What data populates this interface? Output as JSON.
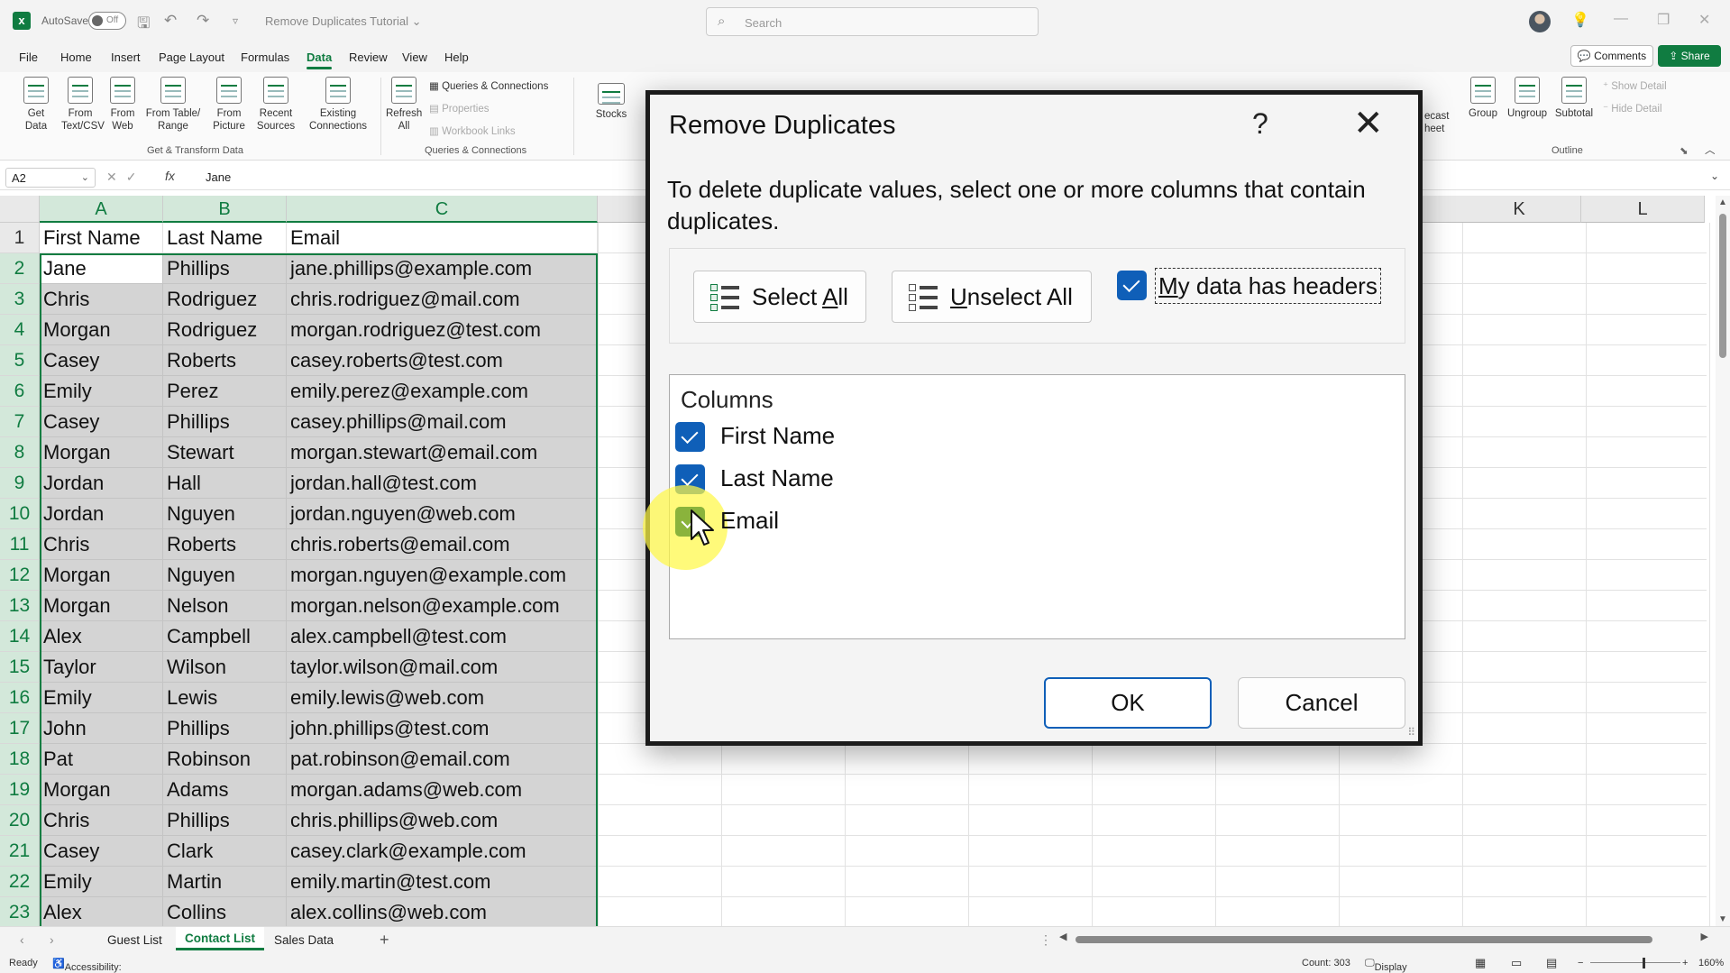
{
  "titlebar": {
    "autosave_label": "AutoSave",
    "autosave_state": "Off",
    "document_title": "Remove Duplicates Tutorial",
    "search_placeholder": "Search"
  },
  "menu": {
    "tabs": [
      "File",
      "Home",
      "Insert",
      "Page Layout",
      "Formulas",
      "Data",
      "Review",
      "View",
      "Help"
    ],
    "active_tab": "Data",
    "comments_label": "Comments",
    "share_label": "Share"
  },
  "ribbon": {
    "get_transform": {
      "buttons": [
        "Get Data",
        "From Text/CSV",
        "From Web",
        "From Table/ Range",
        "From Picture",
        "Recent Sources",
        "Existing Connections"
      ],
      "label": "Get & Transform Data"
    },
    "queries": {
      "refresh_label": "Refresh All",
      "items": [
        "Queries & Connections",
        "Properties",
        "Workbook Links"
      ],
      "label": "Queries & Connections"
    },
    "stocks_label": "Stocks",
    "forecast_label": "ecast heet",
    "outline": {
      "buttons": [
        "Group",
        "Ungroup",
        "Subtotal"
      ],
      "show_detail": "Show Detail",
      "hide_detail": "Hide Detail",
      "label": "Outline"
    }
  },
  "formula_bar": {
    "name_box": "A2",
    "fx": "fx",
    "value": "Jane"
  },
  "sheet": {
    "columns": [
      "A",
      "B",
      "C",
      "K",
      "L"
    ],
    "rows": [
      {
        "n": "1",
        "a": "First Name",
        "b": "Last Name",
        "c": "Email"
      },
      {
        "n": "2",
        "a": "Jane",
        "b": "Phillips",
        "c": "jane.phillips@example.com"
      },
      {
        "n": "3",
        "a": "Chris",
        "b": "Rodriguez",
        "c": "chris.rodriguez@mail.com"
      },
      {
        "n": "4",
        "a": "Morgan",
        "b": "Rodriguez",
        "c": "morgan.rodriguez@test.com"
      },
      {
        "n": "5",
        "a": "Casey",
        "b": "Roberts",
        "c": "casey.roberts@test.com"
      },
      {
        "n": "6",
        "a": "Emily",
        "b": "Perez",
        "c": "emily.perez@example.com"
      },
      {
        "n": "7",
        "a": "Casey",
        "b": "Phillips",
        "c": "casey.phillips@mail.com"
      },
      {
        "n": "8",
        "a": "Morgan",
        "b": "Stewart",
        "c": "morgan.stewart@email.com"
      },
      {
        "n": "9",
        "a": "Jordan",
        "b": "Hall",
        "c": "jordan.hall@test.com"
      },
      {
        "n": "10",
        "a": "Jordan",
        "b": "Nguyen",
        "c": "jordan.nguyen@web.com"
      },
      {
        "n": "11",
        "a": "Chris",
        "b": "Roberts",
        "c": "chris.roberts@email.com"
      },
      {
        "n": "12",
        "a": "Morgan",
        "b": "Nguyen",
        "c": "morgan.nguyen@example.com"
      },
      {
        "n": "13",
        "a": "Morgan",
        "b": "Nelson",
        "c": "morgan.nelson@example.com"
      },
      {
        "n": "14",
        "a": "Alex",
        "b": "Campbell",
        "c": "alex.campbell@test.com"
      },
      {
        "n": "15",
        "a": "Taylor",
        "b": "Wilson",
        "c": "taylor.wilson@mail.com"
      },
      {
        "n": "16",
        "a": "Emily",
        "b": "Lewis",
        "c": "emily.lewis@web.com"
      },
      {
        "n": "17",
        "a": "John",
        "b": "Phillips",
        "c": "john.phillips@test.com"
      },
      {
        "n": "18",
        "a": "Pat",
        "b": "Robinson",
        "c": "pat.robinson@email.com"
      },
      {
        "n": "19",
        "a": "Morgan",
        "b": "Adams",
        "c": "morgan.adams@web.com"
      },
      {
        "n": "20",
        "a": "Chris",
        "b": "Phillips",
        "c": "chris.phillips@web.com"
      },
      {
        "n": "21",
        "a": "Casey",
        "b": "Clark",
        "c": "casey.clark@example.com"
      },
      {
        "n": "22",
        "a": "Emily",
        "b": "Martin",
        "c": "emily.martin@test.com"
      },
      {
        "n": "23",
        "a": "Alex",
        "b": "Collins",
        "c": "alex.collins@web.com"
      }
    ]
  },
  "sheet_tabs": {
    "tabs": [
      "Guest List",
      "Contact List",
      "Sales Data"
    ],
    "active": "Contact List"
  },
  "status": {
    "ready": "Ready",
    "accessibility": "Accessibility: Good to go",
    "count": "Count: 303",
    "display_settings": "Display Settings",
    "zoom": "160%"
  },
  "dialog": {
    "title": "Remove Duplicates",
    "help": "?",
    "instruction": "To delete duplicate values, select one or more columns that contain duplicates.",
    "select_all_pre": "Select ",
    "select_all_acc": "A",
    "select_all_post": "ll",
    "unselect_all_acc": "U",
    "unselect_all_post": "nselect All",
    "headers_acc": "M",
    "headers_post": "y data has headers",
    "headers_checked": true,
    "columns_title": "Columns",
    "columns": [
      {
        "label": "First Name",
        "checked": true
      },
      {
        "label": "Last Name",
        "checked": true
      },
      {
        "label": "Email",
        "checked": true
      }
    ],
    "ok_label": "OK",
    "cancel_label": "Cancel"
  },
  "colors": {
    "excel_green": "#107c41",
    "checkbox_blue": "#0f5fb8",
    "selection_gray": "#d4d4d4",
    "cursor_highlight": "#fff846"
  }
}
